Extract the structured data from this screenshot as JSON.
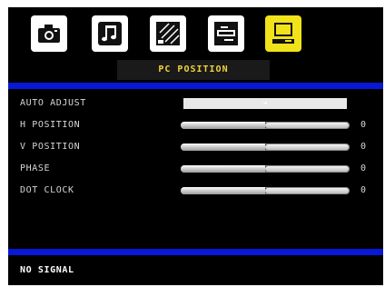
{
  "menu": {
    "title": "PC POSITION",
    "icons": [
      {
        "name": "picture-icon",
        "active": false
      },
      {
        "name": "sound-icon",
        "active": false
      },
      {
        "name": "setup-icon",
        "active": false
      },
      {
        "name": "feature-icon",
        "active": false
      },
      {
        "name": "pc-monitor-icon",
        "active": true
      }
    ],
    "rows": [
      {
        "label": "AUTO ADJUST",
        "type": "action",
        "arrow": "➔"
      },
      {
        "label": "H POSITION",
        "type": "slider",
        "value": "0",
        "level": 0.5
      },
      {
        "label": "V POSITION",
        "type": "slider",
        "value": "0",
        "level": 0.5
      },
      {
        "label": "PHASE",
        "type": "slider",
        "value": "0",
        "level": 0.5
      },
      {
        "label": "DOT CLOCK",
        "type": "slider",
        "value": "0",
        "level": 0.5
      }
    ]
  },
  "status": {
    "text": "NO SIGNAL"
  },
  "colors": {
    "background": "#000000",
    "accent_bar": "#0718d6",
    "active_icon": "#f1e21a",
    "title_text": "#f0d23a"
  }
}
